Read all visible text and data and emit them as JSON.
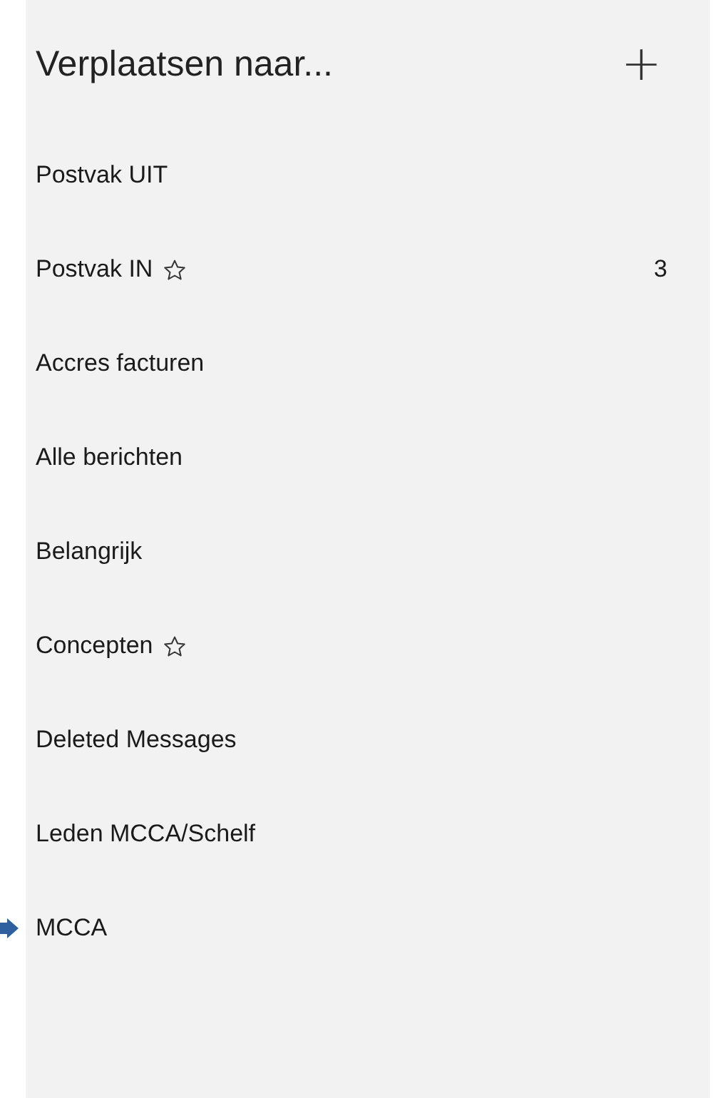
{
  "header": {
    "title": "Verplaatsen naar...",
    "add_button": "+"
  },
  "folders": [
    {
      "label": "Postvak UIT",
      "starred": false
    },
    {
      "label": "Postvak IN",
      "starred": true,
      "count": "3"
    },
    {
      "label": "Accres facturen",
      "starred": false
    },
    {
      "label": "Alle berichten",
      "starred": false
    },
    {
      "label": "Belangrijk",
      "starred": false
    },
    {
      "label": "Concepten",
      "starred": true
    },
    {
      "label": "Deleted Messages",
      "starred": false
    },
    {
      "label": "Leden MCCA/Schelf",
      "starred": false
    },
    {
      "label": "MCCA",
      "starred": false,
      "pointed": true
    }
  ]
}
